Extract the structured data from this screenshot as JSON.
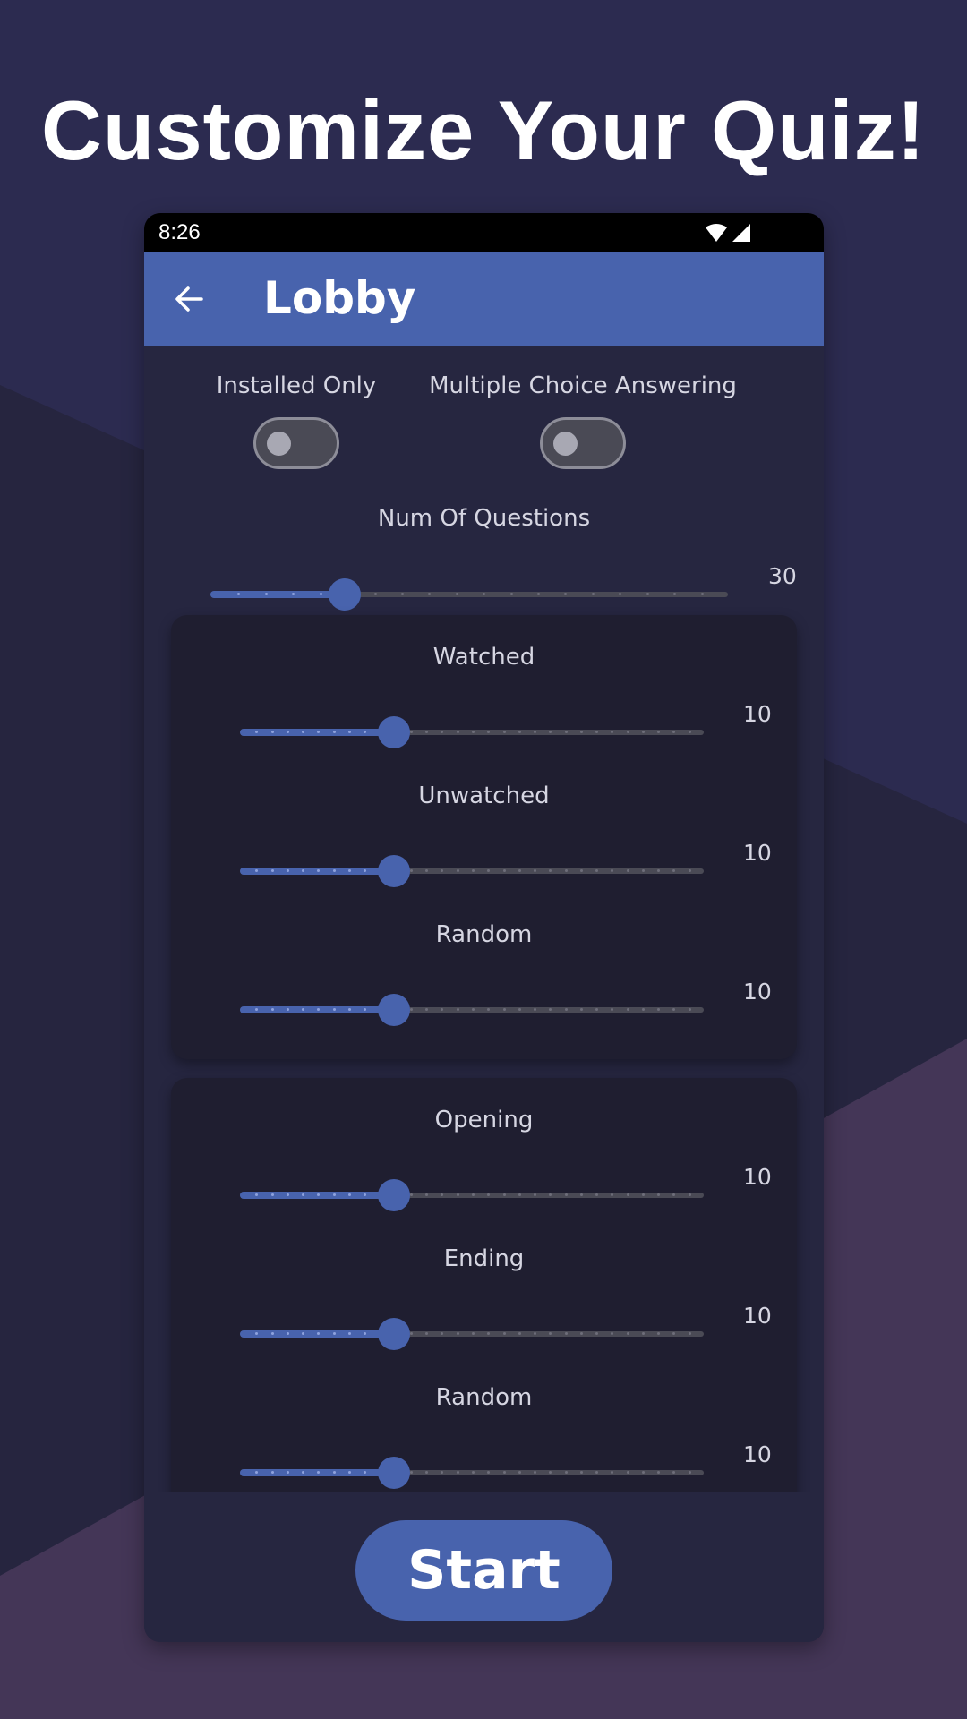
{
  "headline": "Customize Your Quiz!",
  "status_bar": {
    "time": "8:26",
    "icons": [
      "wifi-icon",
      "signal-icon"
    ]
  },
  "app_bar": {
    "title": "Lobby",
    "back_icon": "arrow-back-icon"
  },
  "toggles": [
    {
      "label": "Installed Only",
      "on": false
    },
    {
      "label": "Multiple Choice Answering",
      "on": false
    }
  ],
  "num_questions": {
    "label": "Num Of Questions",
    "value": "30",
    "fraction": 0.26,
    "steps": 19
  },
  "group1": [
    {
      "label": "Watched",
      "value": "10",
      "fraction": 0.333,
      "steps": 30
    },
    {
      "label": "Unwatched",
      "value": "10",
      "fraction": 0.333,
      "steps": 30
    },
    {
      "label": "Random",
      "value": "10",
      "fraction": 0.333,
      "steps": 30
    }
  ],
  "group2": [
    {
      "label": "Opening",
      "value": "10",
      "fraction": 0.333,
      "steps": 30
    },
    {
      "label": "Ending",
      "value": "10",
      "fraction": 0.333,
      "steps": 30
    },
    {
      "label": "Random",
      "value": "10",
      "fraction": 0.333,
      "steps": 30
    }
  ],
  "start_button": "Start",
  "colors": {
    "accent": "#4863ad",
    "background": "#2b2a4e",
    "panel": "#262640",
    "card": "#1f1e30",
    "text": "#d6d6e2"
  }
}
